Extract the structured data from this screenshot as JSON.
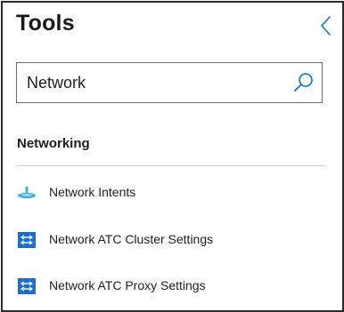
{
  "panel": {
    "title": "Tools"
  },
  "search": {
    "value": "Network",
    "placeholder": ""
  },
  "section": {
    "label": "Networking"
  },
  "tools": [
    {
      "label": "Network Intents",
      "icon": "network-intents-icon"
    },
    {
      "label": "Network ATC Cluster Settings",
      "icon": "network-atc-icon"
    },
    {
      "label": "Network ATC Proxy Settings",
      "icon": "network-atc-icon"
    }
  ],
  "colors": {
    "accent": "#0078d4",
    "icon_blue": "#1e6fc9",
    "intent_cyan": "#3bb3d6"
  }
}
